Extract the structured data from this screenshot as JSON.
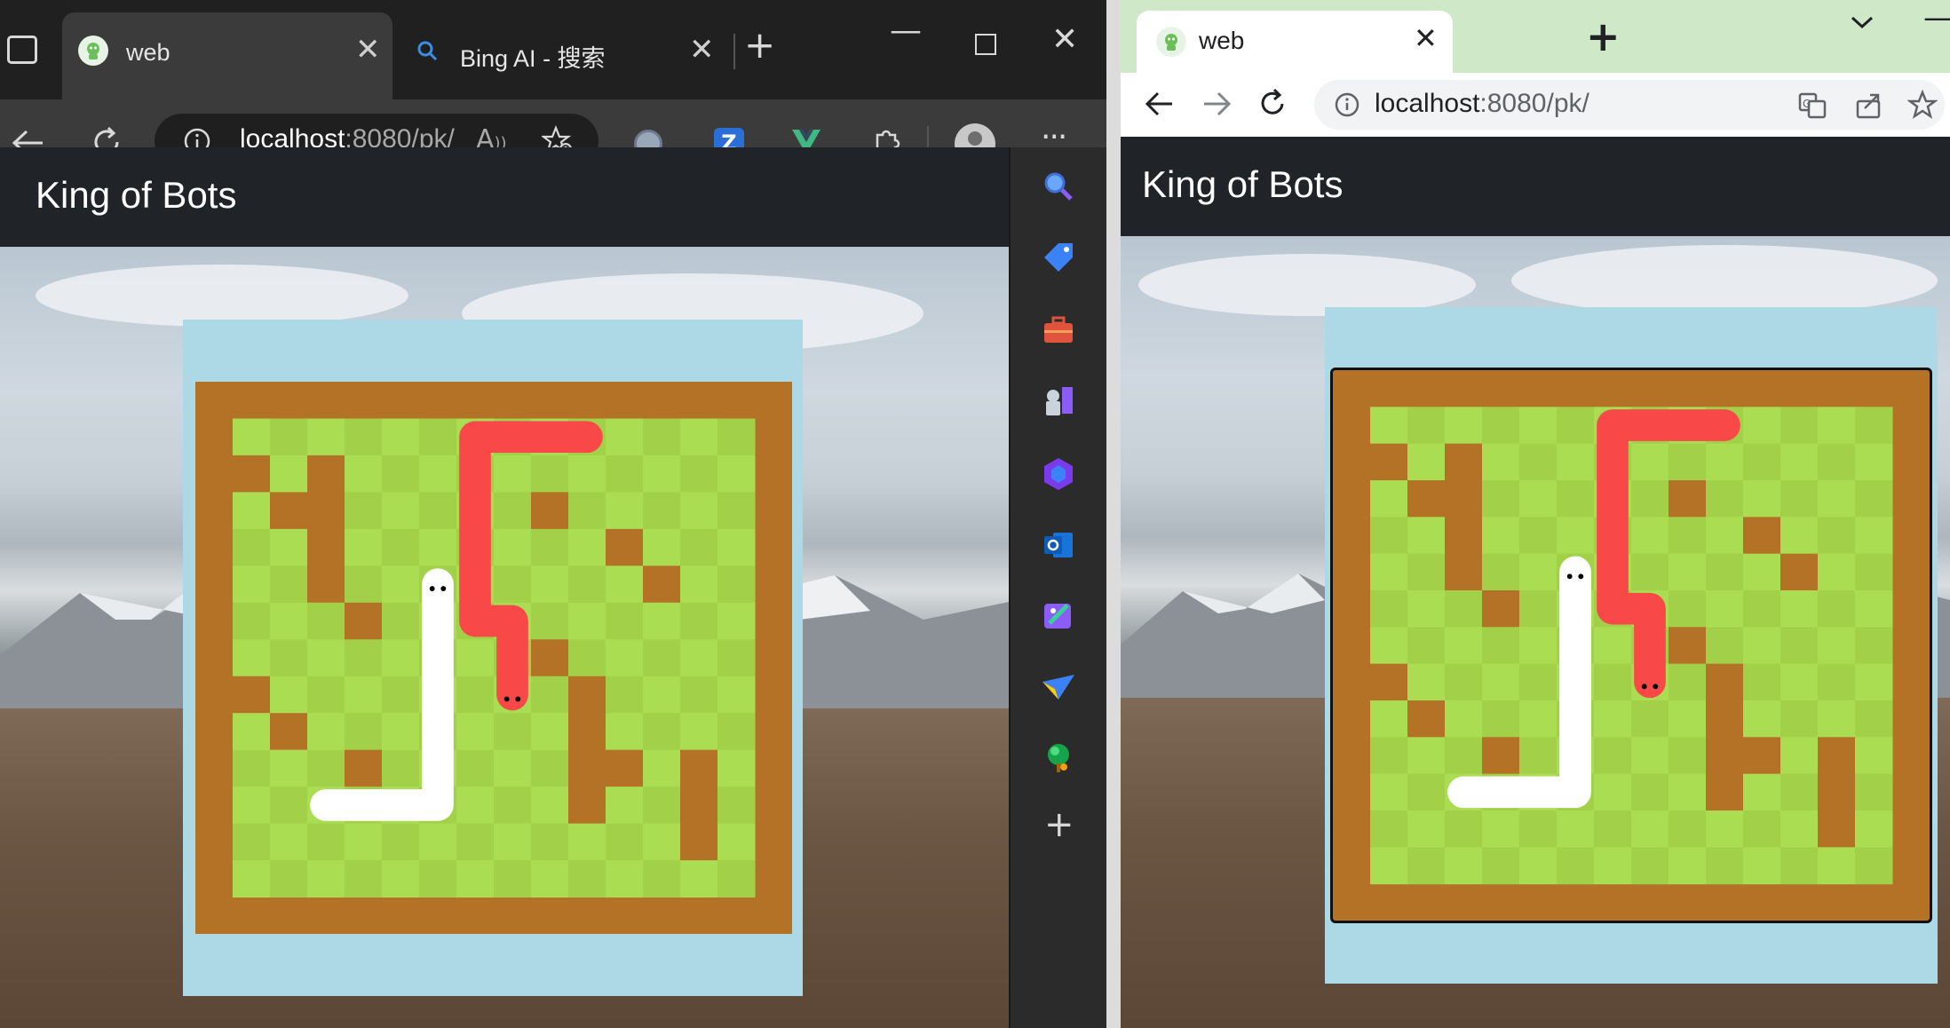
{
  "left_window": {
    "browser": "Edge",
    "tabs": [
      {
        "title": "web",
        "icon": "robot-favicon-icon",
        "active": true
      },
      {
        "title": "Bing AI - 搜索",
        "icon": "search-icon",
        "active": false
      }
    ],
    "address_bar": {
      "host": "localhost",
      "path": ":8080/pk/"
    },
    "toolbar_icons": [
      "back-arrow-icon",
      "refresh-icon",
      "info-icon",
      "read-aloud-icon",
      "add-favorite-icon",
      "extension-circle-icon",
      "extension-z-icon",
      "vue-devtools-icon",
      "extensions-puzzle-icon",
      "profile-avatar-icon",
      "more-menu-icon"
    ],
    "sidebar_icons": [
      "search-icon",
      "shopping-tag-icon",
      "tools-briefcase-icon",
      "games-icon",
      "microsoft365-icon",
      "outlook-icon",
      "designer-icon",
      "drop-send-icon",
      "tree-icon",
      "add-icon"
    ],
    "window_controls": [
      "minimize-icon",
      "maximize-icon",
      "close-icon"
    ],
    "page": {
      "brand": "King of Bots"
    }
  },
  "right_window": {
    "browser": "Chrome",
    "tabs": [
      {
        "title": "web",
        "icon": "robot-favicon-icon",
        "active": true
      }
    ],
    "address_bar": {
      "host": "localhost",
      "path": ":8080/pk/"
    },
    "toolbar_icons": [
      "back-arrow-icon",
      "forward-arrow-icon",
      "refresh-icon",
      "info-icon",
      "translate-icon",
      "share-icon",
      "bookmark-star-icon"
    ],
    "page": {
      "brand": "King of Bots"
    }
  },
  "game": {
    "rows": 13,
    "cols": 14,
    "colors": {
      "wall": "#b47226",
      "grass_light": "#aadd52",
      "grass_dark": "#a2d149",
      "snake_white": "#ffffff",
      "snake_red": "#f94848",
      "playground": "#add8e6"
    },
    "walls": [
      [
        1,
        0
      ],
      [
        1,
        2
      ],
      [
        2,
        1
      ],
      [
        2,
        2
      ],
      [
        3,
        2
      ],
      [
        4,
        2
      ],
      [
        5,
        3
      ],
      [
        2,
        8
      ],
      [
        3,
        10
      ],
      [
        4,
        11
      ],
      [
        6,
        8
      ],
      [
        7,
        0
      ],
      [
        8,
        1
      ],
      [
        9,
        3
      ],
      [
        7,
        9
      ],
      [
        8,
        9
      ],
      [
        9,
        9
      ],
      [
        10,
        9
      ],
      [
        9,
        10
      ],
      [
        10,
        12
      ],
      [
        11,
        12
      ],
      [
        9,
        12
      ]
    ],
    "snake_white": [
      [
        4,
        5
      ],
      [
        5,
        5
      ],
      [
        6,
        5
      ],
      [
        7,
        5
      ],
      [
        8,
        5
      ],
      [
        9,
        5
      ],
      [
        10,
        5
      ],
      [
        10,
        4
      ],
      [
        10,
        3
      ],
      [
        10,
        2
      ]
    ],
    "snake_red": [
      [
        7,
        7
      ],
      [
        6,
        7
      ],
      [
        5,
        7
      ],
      [
        5,
        6
      ],
      [
        4,
        6
      ],
      [
        3,
        6
      ],
      [
        2,
        6
      ],
      [
        1,
        6
      ],
      [
        0,
        6
      ],
      [
        0,
        7
      ],
      [
        0,
        8
      ],
      [
        0,
        9
      ]
    ]
  }
}
